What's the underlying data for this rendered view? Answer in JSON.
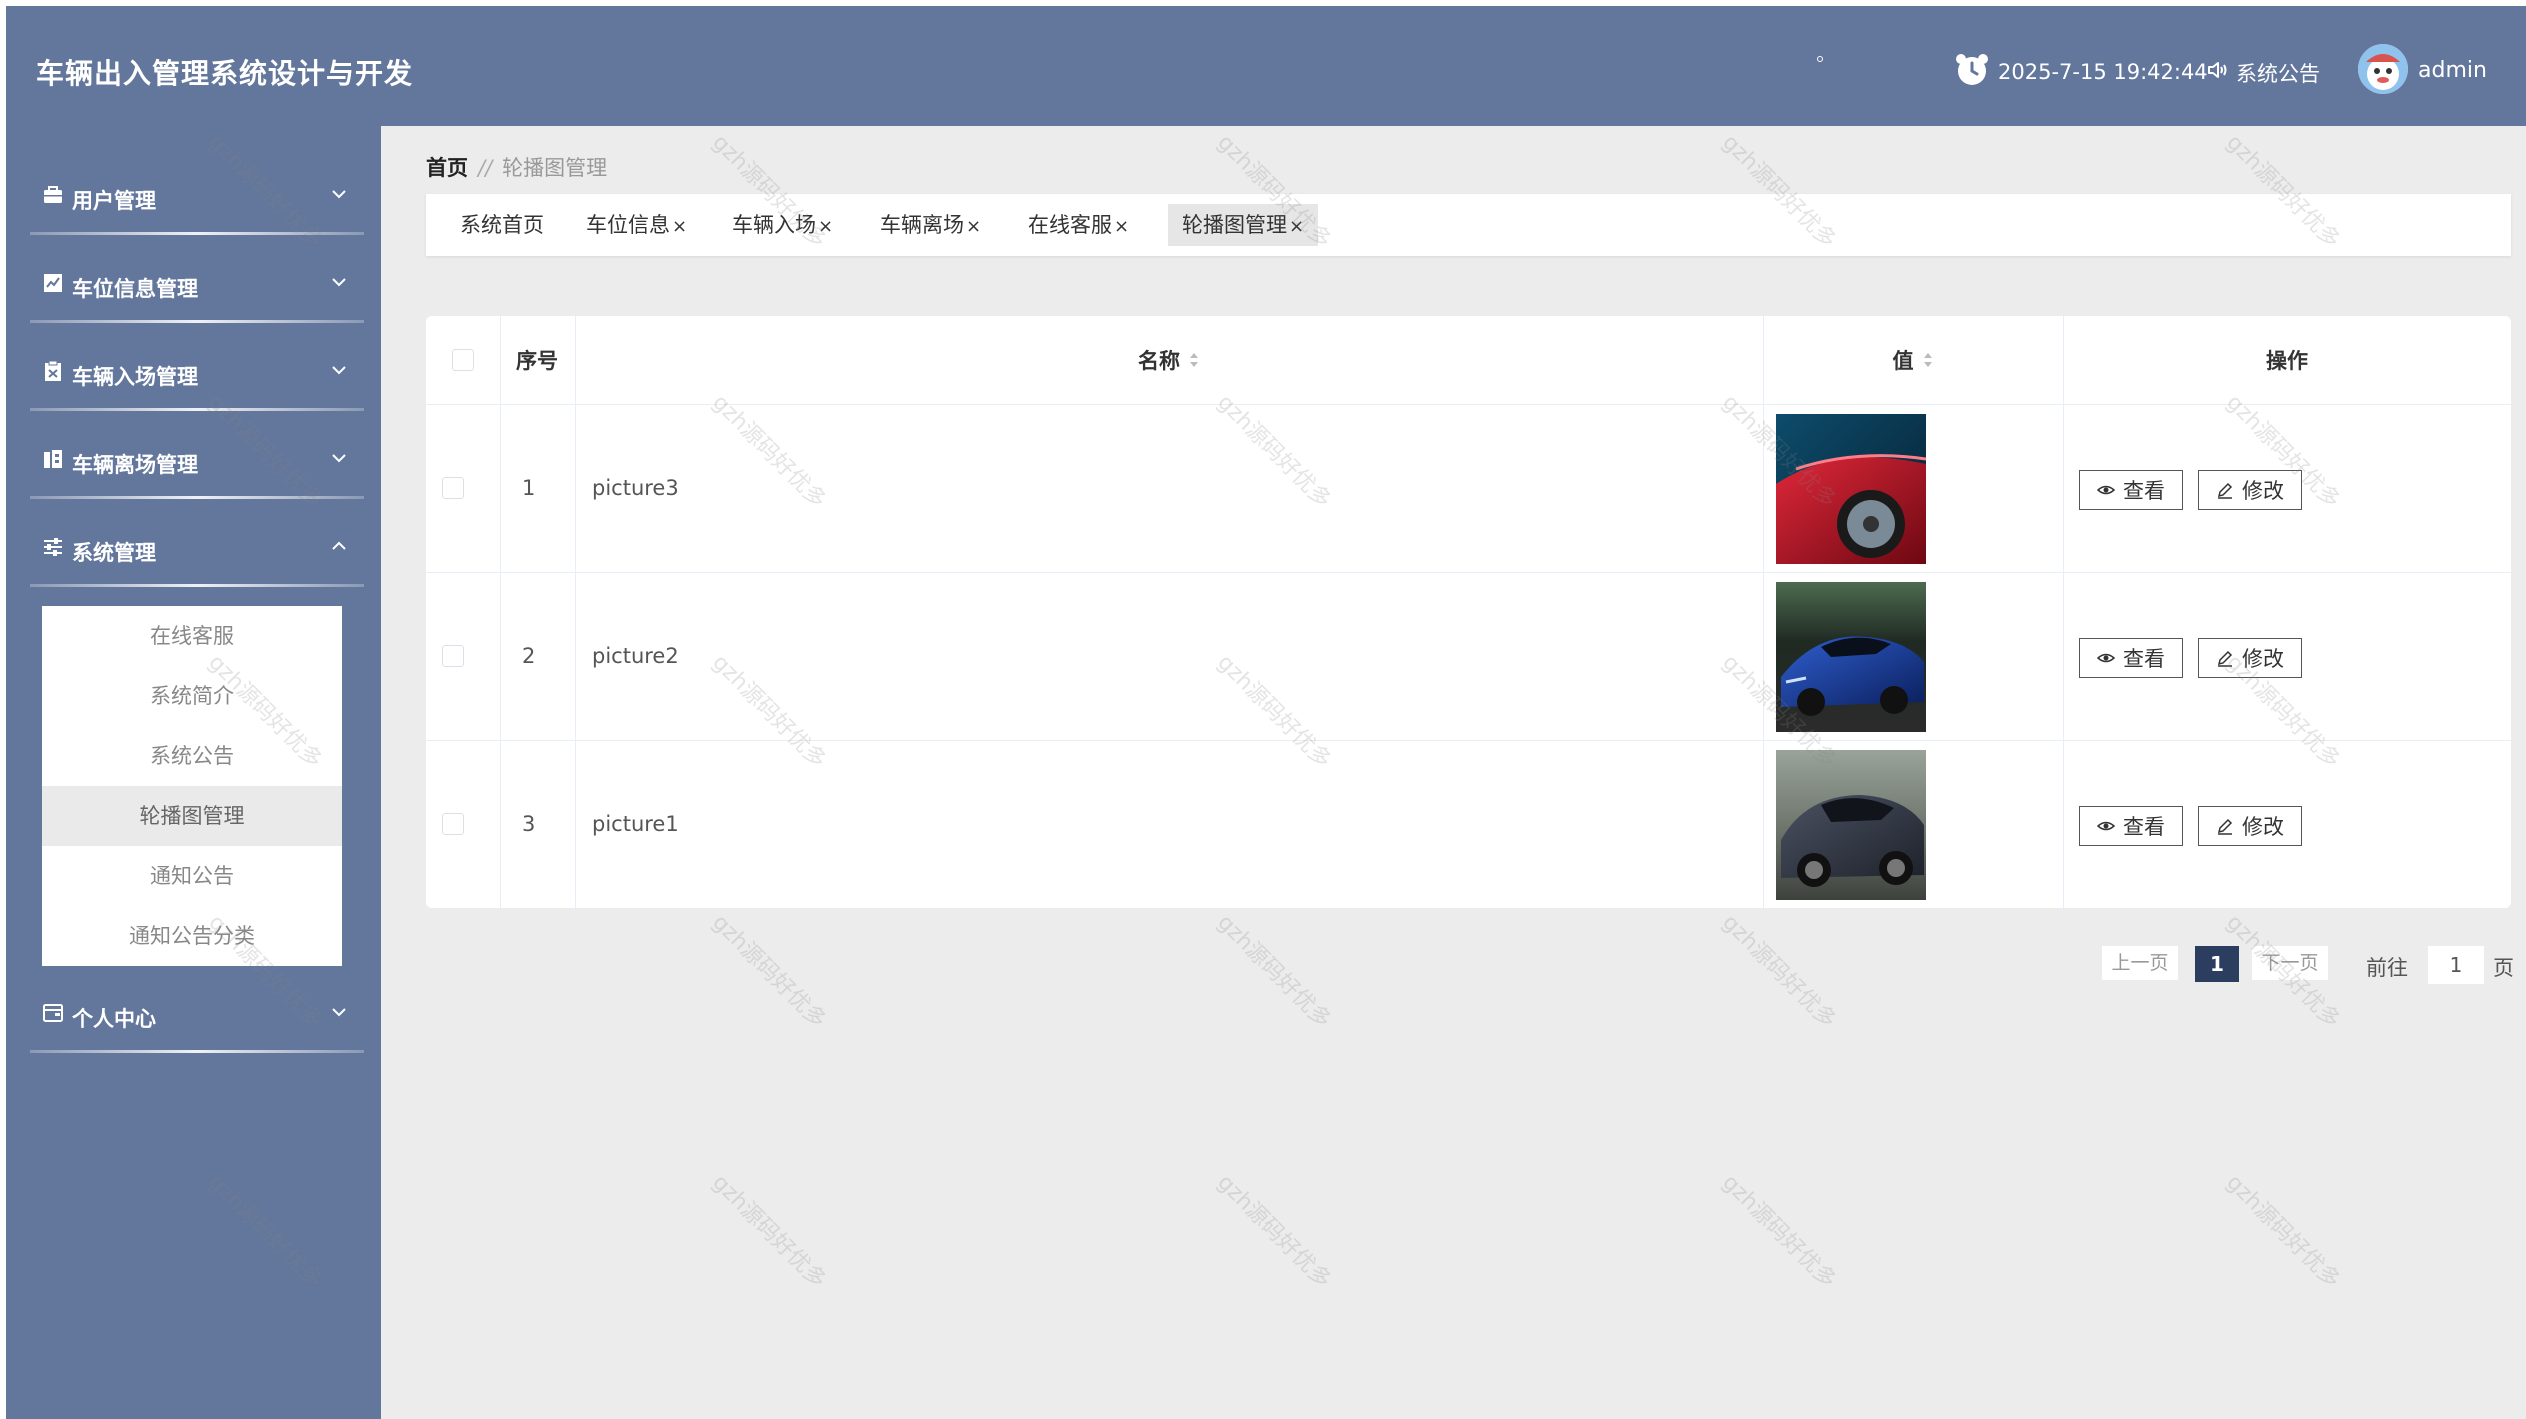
{
  "header": {
    "title": "车辆出入管理系统设计与开发",
    "datetime": "2025-7-15 19:42:44",
    "notice_label": "系统公告",
    "username": "admin"
  },
  "sidebar": {
    "items": [
      {
        "label": "用户管理",
        "icon": "briefcase-icon",
        "expanded": false
      },
      {
        "label": "车位信息管理",
        "icon": "chart-icon",
        "expanded": false
      },
      {
        "label": "车辆入场管理",
        "icon": "clipboard-icon",
        "expanded": false
      },
      {
        "label": "车辆离场管理",
        "icon": "buildings-icon",
        "expanded": false
      },
      {
        "label": "系统管理",
        "icon": "sliders-icon",
        "expanded": true
      },
      {
        "label": "个人中心",
        "icon": "wallet-icon",
        "expanded": false
      }
    ],
    "submenu": [
      "在线客服",
      "系统简介",
      "系统公告",
      "轮播图管理",
      "通知公告",
      "通知公告分类"
    ],
    "submenu_active": "轮播图管理"
  },
  "breadcrumb": {
    "home": "首页",
    "separator": "//",
    "current": "轮播图管理"
  },
  "tabs": [
    {
      "label": "系统首页",
      "closable": false
    },
    {
      "label": "车位信息",
      "closable": true
    },
    {
      "label": "车辆入场",
      "closable": true
    },
    {
      "label": "车辆离场",
      "closable": true
    },
    {
      "label": "在线客服",
      "closable": true
    },
    {
      "label": "轮播图管理",
      "closable": true,
      "active": true
    }
  ],
  "tab_close_glyph": "×",
  "table": {
    "headers": {
      "index": "序号",
      "name": "名称",
      "value": "值",
      "actions": "操作"
    },
    "rows": [
      {
        "index": "1",
        "name": "picture3",
        "image": "red-sports-car"
      },
      {
        "index": "2",
        "name": "picture2",
        "image": "blue-sports-car"
      },
      {
        "index": "3",
        "name": "picture1",
        "image": "grey-sports-car"
      }
    ],
    "view_label": "查看",
    "edit_label": "修改"
  },
  "pagination": {
    "prev": "上一页",
    "current": "1",
    "next": "下一页",
    "goto_label": "前往",
    "goto_value": "1",
    "page_suffix": "页"
  },
  "colors": {
    "header_bg": "#63779c",
    "sidebar_bg": "#63779c",
    "page_bg": "#ececec",
    "pagination_active": "#2c3e5f"
  }
}
